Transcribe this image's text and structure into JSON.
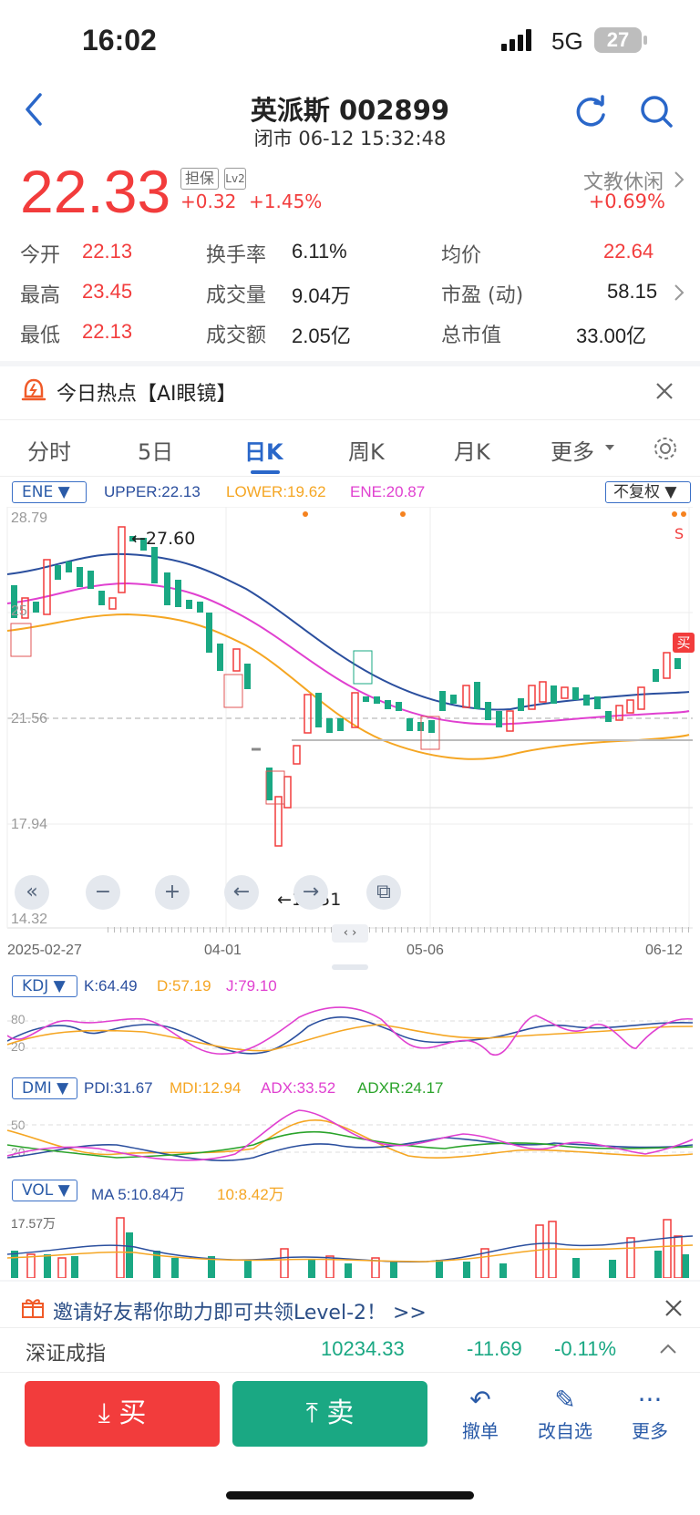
{
  "status": {
    "time": "16:02",
    "network": "5G",
    "battery": "27"
  },
  "header": {
    "title": "英派斯 002899",
    "subtitle": "闭市 06-12 15:32:48"
  },
  "quote": {
    "price": "22.33",
    "tag1": "担保",
    "tag2": "Lv2",
    "change": "+0.32",
    "change_pct": "+1.45%",
    "sector": "文教休闲",
    "sector_change": "+0.69%"
  },
  "stats": {
    "open_label": "今开",
    "open": "22.13",
    "turnover_label": "换手率",
    "turnover": "6.11%",
    "avg_label": "均价",
    "avg": "22.64",
    "high_label": "最高",
    "high": "23.45",
    "volume_label": "成交量",
    "volume": "9.04万",
    "pe_label": "市盈 (动)",
    "pe": "58.15",
    "low_label": "最低",
    "low": "22.13",
    "amount_label": "成交额",
    "amount": "2.05亿",
    "mcap_label": "总市值",
    "mcap": "33.00亿"
  },
  "hot": {
    "text": "今日热点【AI眼镜】"
  },
  "tabs": [
    "分时",
    "5日",
    "日K",
    "周K",
    "月K",
    "更多"
  ],
  "main_chart": {
    "indicator": "ENE",
    "upper": "UPPER:22.13",
    "lower": "LOWER:19.62",
    "ene": "ENE:20.87",
    "adjust": "不复权",
    "y_labels": [
      "28.79",
      "25",
      "21.56",
      "17.94",
      "14.32"
    ],
    "high_mark": "←27.60",
    "low_mark": "←15.51",
    "x_labels": [
      "2025-02-27",
      "04-01",
      "05-06",
      "06-12"
    ],
    "buy_tag": "买",
    "sell_tag": "S"
  },
  "kdj": {
    "name": "KDJ",
    "k": "K:64.49",
    "d": "D:57.19",
    "j": "J:79.10",
    "y_labels": [
      "80",
      "20"
    ]
  },
  "dmi": {
    "name": "DMI",
    "pdi": "PDI:31.67",
    "mdi": "MDI:12.94",
    "adx": "ADX:33.52",
    "adxr": "ADXR:24.17",
    "y_labels": [
      "50",
      "20"
    ]
  },
  "vol": {
    "name": "VOL",
    "ma5": "MA 5:10.84万",
    "ma10": "10:8.42万",
    "y_label": "17.57万"
  },
  "invite": {
    "text": "邀请好友帮你助力即可共领Level-2！ >>"
  },
  "index": {
    "name": "深证成指",
    "value": "10234.33",
    "change": "-11.69",
    "change_pct": "-0.11%"
  },
  "actions": {
    "buy": "买",
    "sell": "卖",
    "cancel": "撤单",
    "watchlist": "改自选",
    "more": "更多"
  },
  "colors": {
    "up": "#f23c3c",
    "down": "#1aa883",
    "accent": "#2a67c9",
    "upper_line": "#2b4f9e",
    "lower_line": "#f5a623",
    "ene_line": "#e040d0"
  }
}
